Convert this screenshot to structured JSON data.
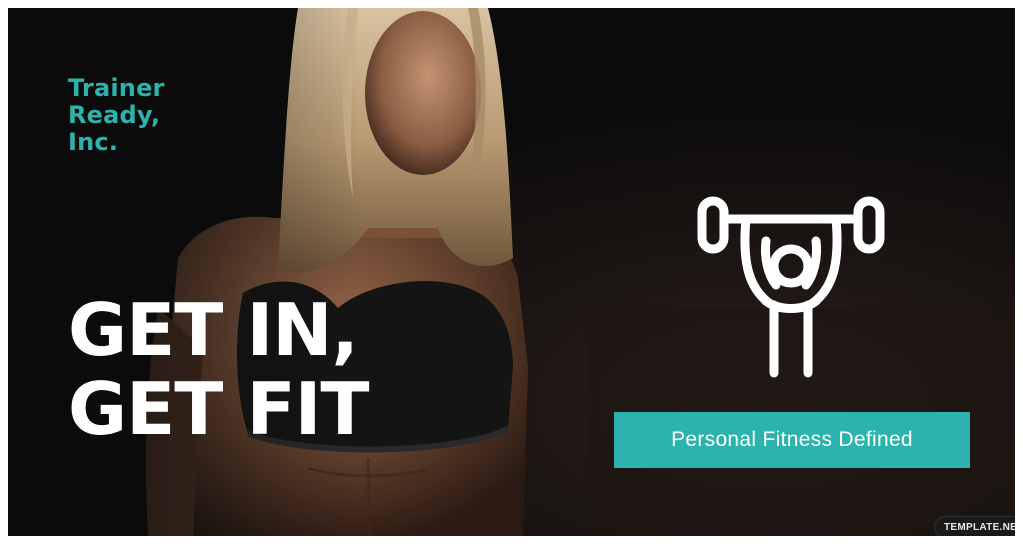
{
  "brand": {
    "lines": [
      "Trainer",
      "Ready,",
      "Inc."
    ],
    "color": "#2bb3ad"
  },
  "headline": {
    "lines": [
      "GET IN,",
      "GET FIT"
    ],
    "color": "#ffffff"
  },
  "logo": {
    "icon": "weightlifter-icon"
  },
  "tagline": {
    "text": "Personal Fitness Defined",
    "background": "#2bb3ad"
  },
  "watermark": {
    "text": "TEMPLATE.NET"
  },
  "photo": {
    "subject": "woman-athlete-photo"
  }
}
